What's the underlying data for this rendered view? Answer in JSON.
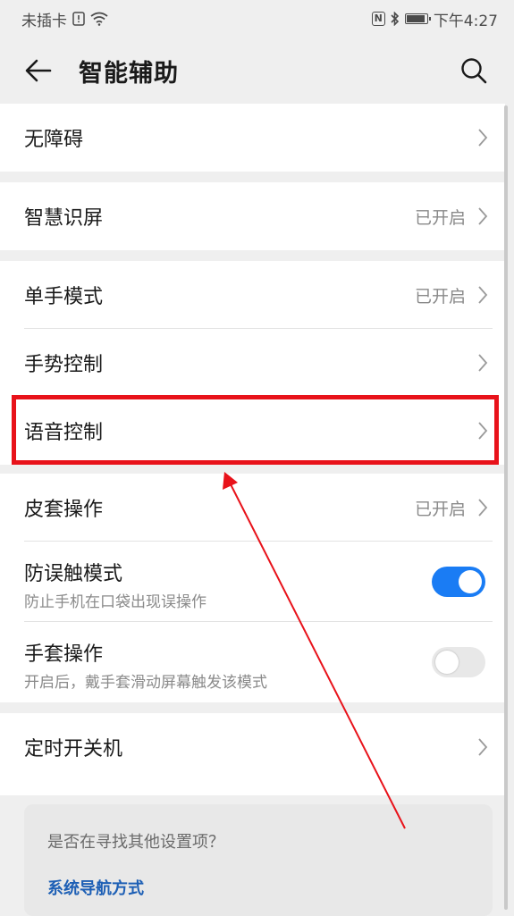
{
  "status_bar": {
    "carrier": "未插卡",
    "nfc_label": "N",
    "bluetooth_icon": "bluetooth-icon",
    "battery_level": 0.85,
    "time": "下午4:27"
  },
  "header": {
    "title": "智能辅助",
    "back_icon": "back-arrow-icon",
    "search_icon": "search-icon"
  },
  "groups": {
    "g1": {
      "item0": {
        "label": "无障碍"
      }
    },
    "g2": {
      "item0": {
        "label": "智慧识屏",
        "value": "已开启"
      }
    },
    "g3": {
      "item0": {
        "label": "单手模式",
        "value": "已开启"
      },
      "item1": {
        "label": "手势控制"
      },
      "item2": {
        "label": "语音控制"
      }
    },
    "g4": {
      "item0": {
        "label": "皮套操作",
        "value": "已开启"
      },
      "item1": {
        "label": "防误触模式",
        "subtitle": "防止手机在口袋出现误操作",
        "toggle_on": true
      },
      "item2": {
        "label": "手套操作",
        "subtitle": "开启后，戴手套滑动屏幕触发该模式",
        "toggle_on": false
      }
    },
    "g5": {
      "item0": {
        "label": "定时开关机"
      }
    }
  },
  "suggestion": {
    "question": "是否在寻找其他设置项？",
    "link": "系统导航方式"
  },
  "annotation": {
    "highlight_color": "#e8121a",
    "arrow_color": "#e8121a",
    "highlight_target": "语音控制"
  },
  "colors": {
    "accent": "#1a7cf4",
    "link": "#1d5fb5",
    "background": "#efefef"
  }
}
